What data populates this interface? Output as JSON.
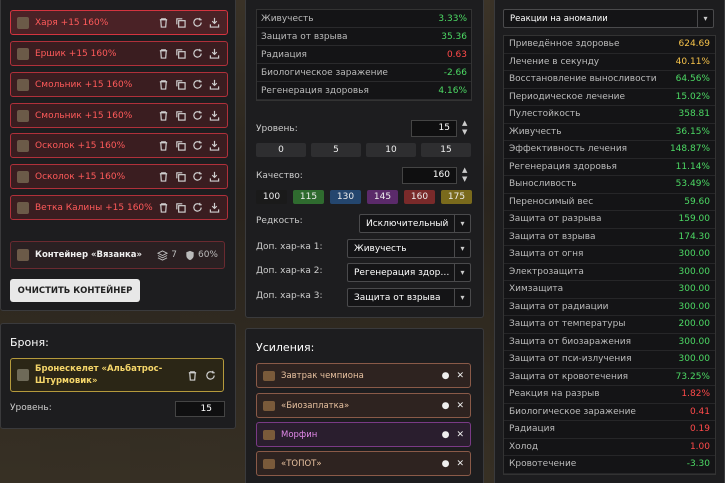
{
  "inventory": {
    "items": [
      {
        "name": "Харя +15 160%"
      },
      {
        "name": "Ершик +15 160%"
      },
      {
        "name": "Смольник +15 160%"
      },
      {
        "name": "Смольник +15 160%"
      },
      {
        "name": "Осколок +15 160%"
      },
      {
        "name": "Осколок +15 160%"
      },
      {
        "name": "Ветка Калины +15 160%"
      }
    ],
    "container": {
      "name": "Контейнер «Вязанка»",
      "slots": "7",
      "protection": "60%"
    },
    "clear_label": "ОЧИСТИТЬ КОНТЕЙНЕР"
  },
  "armor": {
    "title": "Броня:",
    "item_name": "Бронескелет «Альбатрос-Штурмовик»",
    "level_label": "Уровень:",
    "level_value": "15"
  },
  "item_stats": [
    {
      "label": "Живучесть",
      "value": "3.33%",
      "color": "green"
    },
    {
      "label": "Защита от взрыва",
      "value": "35.36",
      "color": "green"
    },
    {
      "label": "Радиация",
      "value": "0.63",
      "color": "red"
    },
    {
      "label": "Биологическое заражение",
      "value": "-2.66",
      "color": "green"
    },
    {
      "label": "Регенерация здоровья",
      "value": "4.16%",
      "color": "green"
    }
  ],
  "editor": {
    "level_label": "Уровень:",
    "level_value": "15",
    "level_presets": [
      "0",
      "5",
      "10",
      "15"
    ],
    "quality_label": "Качество:",
    "quality_value": "160",
    "quality_presets": [
      {
        "label": "100",
        "color": "#1a1a1a"
      },
      {
        "label": "115",
        "color": "#2f6b2f"
      },
      {
        "label": "130",
        "color": "#24466e"
      },
      {
        "label": "145",
        "color": "#5b2a6a"
      },
      {
        "label": "160",
        "color": "#7a2a2a"
      },
      {
        "label": "175",
        "color": "#7a6a1c"
      }
    ],
    "rarity_label": "Редкость:",
    "rarity_value": "Исключительный",
    "extra1_label": "Доп. хар-ка 1:",
    "extra1_value": "Живучесть",
    "extra2_label": "Доп. хар-ка 2:",
    "extra2_value": "Регенерация здор…",
    "extra3_label": "Доп. хар-ка 3:",
    "extra3_value": "Защита от взрыва"
  },
  "boosts": {
    "title": "Усиления:",
    "items": [
      {
        "name": "Завтрак чемпиона",
        "color": "#e8c2a0",
        "border": "#8a5a48",
        "bg": "#2e2320"
      },
      {
        "name": "«Биозаплатка»",
        "color": "#e8c2a0",
        "border": "#8a5a48",
        "bg": "#2e2320"
      },
      {
        "name": "Морфин",
        "color": "#e088e8",
        "border": "#7a3a86",
        "bg": "#2a1e2e"
      },
      {
        "name": "«ТОПОТ»",
        "color": "#e8c2a0",
        "border": "#8a5a48",
        "bg": "#2e2320"
      }
    ]
  },
  "summary": {
    "filter_value": "Реакции на аномалии",
    "rows": [
      {
        "label": "Приведённое здоровье",
        "value": "624.69",
        "color": "yellow"
      },
      {
        "label": "Лечение в секунду",
        "value": "40.11%",
        "color": "yellow"
      },
      {
        "label": "Восстановление выносливости",
        "value": "64.56%",
        "color": "green"
      },
      {
        "label": "Периодическое лечение",
        "value": "15.02%",
        "color": "green"
      },
      {
        "label": "Пулестойкость",
        "value": "358.81",
        "color": "green"
      },
      {
        "label": "Живучесть",
        "value": "36.15%",
        "color": "green"
      },
      {
        "label": "Эффективность лечения",
        "value": "148.87%",
        "color": "green"
      },
      {
        "label": "Регенерация здоровья",
        "value": "11.14%",
        "color": "green"
      },
      {
        "label": "Выносливость",
        "value": "53.49%",
        "color": "green"
      },
      {
        "label": "Переносимый вес",
        "value": "59.60",
        "color": "green"
      },
      {
        "label": "Защита от разрыва",
        "value": "159.00",
        "color": "green"
      },
      {
        "label": "Защита от взрыва",
        "value": "174.30",
        "color": "green"
      },
      {
        "label": "Защита от огня",
        "value": "300.00",
        "color": "green"
      },
      {
        "label": "Электрозащита",
        "value": "300.00",
        "color": "green"
      },
      {
        "label": "Химзащита",
        "value": "300.00",
        "color": "green"
      },
      {
        "label": "Защита от радиации",
        "value": "300.00",
        "color": "green"
      },
      {
        "label": "Защита от температуры",
        "value": "200.00",
        "color": "green"
      },
      {
        "label": "Защита от биозаражения",
        "value": "300.00",
        "color": "green"
      },
      {
        "label": "Защита от пси-излучения",
        "value": "300.00",
        "color": "green"
      },
      {
        "label": "Защита от кровотечения",
        "value": "73.25%",
        "color": "green"
      },
      {
        "label": "Реакция на разрыв",
        "value": "1.82%",
        "color": "red"
      },
      {
        "label": "Биологическое заражение",
        "value": "0.41",
        "color": "red"
      },
      {
        "label": "Радиация",
        "value": "0.19",
        "color": "red"
      },
      {
        "label": "Холод",
        "value": "1.00",
        "color": "red"
      },
      {
        "label": "Кровотечение",
        "value": "-3.30",
        "color": "green"
      }
    ]
  }
}
